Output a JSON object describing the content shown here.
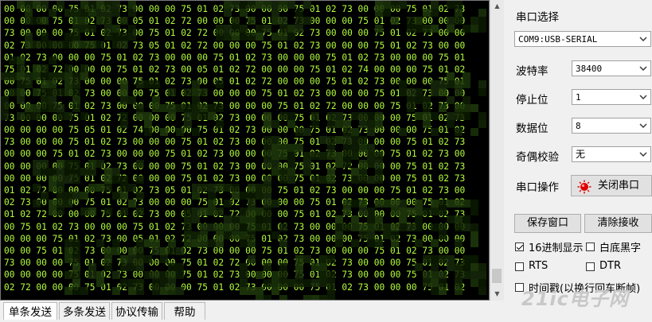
{
  "terminal": {
    "lines": [
      "00 00 00 00 75 01 02 73 00 00 00 75 01 02 73 00 00 00 75 01 02 73 00 00 00 75 01 02 73",
      "00 00 00 75 01 02 73 00 05 01 02 72 00 00 00 75 01 02 73 00 00 00 75 01 02 73 00 00 00",
      "73 00 00 00 75 01 02 73 00 75 01 02 72 00 00 00 75 01 02 73 00 00 00 75 01 02 73 00 00",
      "02 73 00 00 00 75 01 02 73 05 01 02 72 00 00 00 75 01 02 73 00 00 00 75 01 02 73 00 00",
      "01 02 73 00 00 00 75 01 02 73 00 00 00 75 01 02 73 00 00 00 75 01 02 73 00 00 00 75 01",
      "75 01 02 72 00 00 00 75 01 02 73 00 05 01 02 72 00 00 00 75 01 02 74 00 00 00 75 01 02",
      "00 75 01 02 73 00 00 00 75 01 02 73 00 05 01 02 72 00 00 00 75 01 02 73 00 00 00 75 01",
      "00 00 75 01 02 73 00 00 00 75 01 02 73 00 00 00 75 01 02 73 00 00 00 75 01 02 73 00 00",
      "00 00 00 75 01 02 73 00 00 00 75 01 02 73 00 00 00 75 01 02 72 00 00 00 75 01 02 73 00",
      "73 00 00 00 75 01 02 72 00 00 00 75 01 02 73 00 00 00 75 01 02 73 00 00 00 75 01 02 73",
      "00 00 00 00 75 05 01 02 74 00 00 00 75 01 02 73 00 00 00 75 01 02 73 00 00 00 75 01 02",
      "73 00 00 00 75 01 02 73 00 00 00 75 01 02 73 00 00 00 75 01 02 73 00 00 00 75 01 02 73",
      "00 00 00 75 01 02 73 00 00 00 75 01 02 73 00 00 00 75 01 02 73 00 00 00 75 01 02 73 00",
      "00 00 00 00 75 01 02 73 00 00 00 75 01 02 73 00 00 00 75 01 02 72 00 00 00 75 01 02 73",
      "00 00 00 00 75 01 02 72 00 00 00 75 01 02 73 00 00 00 75 01 02 73 00 00 00 75 01 02 73",
      "01 02 72 00 00 00 75 01 02 73 05 01 02 73 00 00 00 75 01 02 73 00 00 00 75 01 02 73 00",
      "02 73 00 00 00 75 01 02 73 00 00 00 75 01 02 73 00 00 00 75 01 02 73 00 00 00 75 01 02",
      "01 02 72 00 00 00 75 01 02 73 00 05 01 02 72 00 00 00 75 01 02 73 00 00 00 75 01 02 73",
      "00 75 01 02 73 00 00 00 75 01 02 73 00 00 00 75 01 02 73 00 00 00 75 01 02 73 00 00 00",
      "00 00 00 75 01 02 73 00 05 01 02 72 00 00 00 75 01 02 73 00 00 00 75 01 02 73 00 00 00",
      "00 00 75 01 02 73 00 00 00 75 01 02 73 00 00 00 75 01 02 73 00 00 00 75 01 02 73 00 00",
      "73 00 00 00 75 01 02 73 00 00 00 75 01 02 72 00 00 00 75 01 02 73 00 00 00 75 01 02 73",
      "00 00 00 00 75 01 02 73 00 00 00 75 01 02 73 00 00 00 75 01 02 73 00 00 00 75 01 02 73",
      "02 72 00 00 00 75 01 02 73 00 00 00 75 01 02 73 00 00 00 75 01 02 73 00 00 00 75 01 02"
    ]
  },
  "panel": {
    "port_select_label": "串口选择",
    "port_value": "COM9:USB-SERIAL",
    "baud_label": "波特率",
    "baud_value": "38400",
    "stopbits_label": "停止位",
    "stopbits_value": "1",
    "databits_label": "数据位",
    "databits_value": "8",
    "parity_label": "奇偶校验",
    "parity_value": "无",
    "port_op_label": "串口操作",
    "close_port_button": "关闭串口",
    "save_window_button": "保存窗口",
    "clear_receive_button": "清除接收",
    "hex_display_label": "16进制显示",
    "hex_display_checked": true,
    "white_bg_label": "白底黑字",
    "white_bg_checked": false,
    "rts_label": "RTS",
    "dtr_label": "DTR",
    "timestamp_label": "时间戳(以换行回车断帧)"
  },
  "tabs": [
    "单条发送",
    "多条发送",
    "协议传输",
    "帮助"
  ],
  "colors": {
    "terminal_bg": "#000000",
    "terminal_text": "#b4ff3c",
    "window_bg": "#f0f0f0",
    "indicator_red": "#e00000"
  },
  "watermark": "21ic电子网"
}
